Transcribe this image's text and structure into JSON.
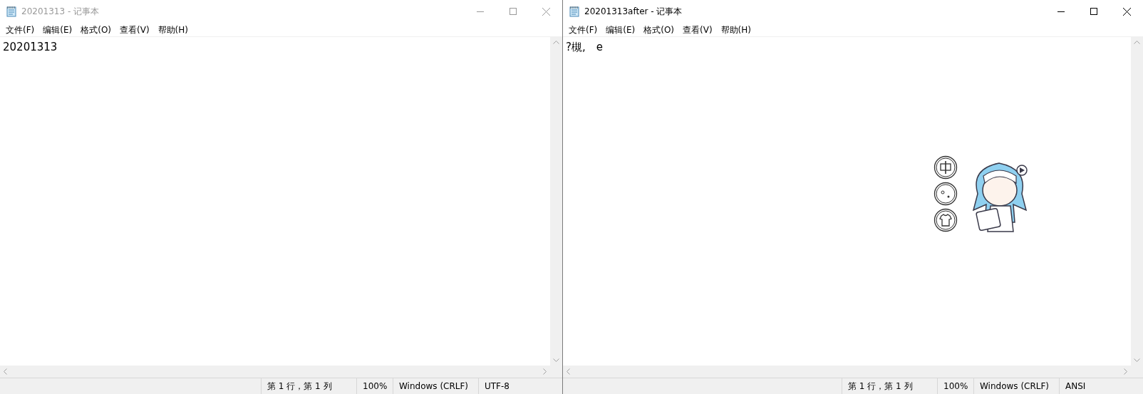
{
  "windows": [
    {
      "title": "20201313 - 记事本",
      "active": false,
      "menu": [
        "文件(F)",
        "编辑(E)",
        "格式(O)",
        "查看(V)",
        "帮助(H)"
      ],
      "text": "20201313",
      "status": [
        "第 1 行，第 1 列",
        "100%",
        "Windows (CRLF)",
        "UTF-8"
      ]
    },
    {
      "title": "20201313after - 记事本",
      "active": true,
      "menu": [
        "文件(F)",
        "编辑(E)",
        "格式(O)",
        "查看(V)",
        "帮助(H)"
      ],
      "text": "?槻,　e",
      "status": [
        "第 1 行，第 1 列",
        "100%",
        "Windows (CRLF)",
        "ANSI"
      ]
    }
  ]
}
